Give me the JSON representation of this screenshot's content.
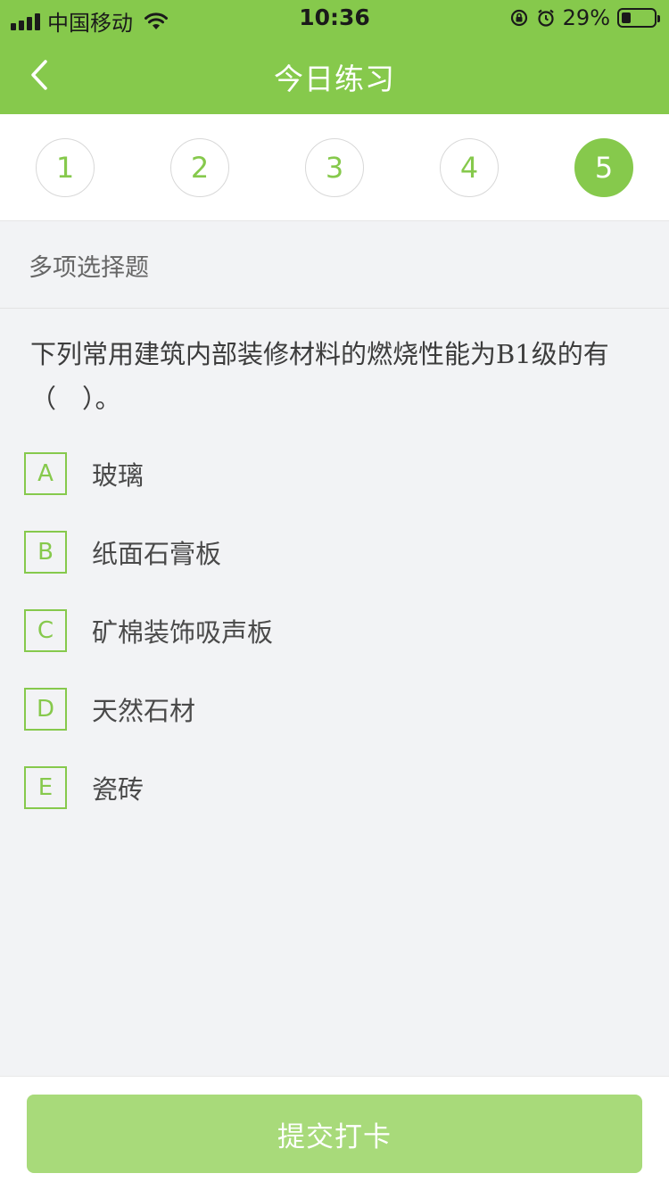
{
  "status_bar": {
    "carrier": "中国移动",
    "time": "10:36",
    "battery_percent": "29%",
    "battery_level": 0.29,
    "icons": [
      "signal-icon",
      "wifi-icon",
      "rotation-lock-icon",
      "alarm-icon",
      "battery-icon"
    ]
  },
  "header": {
    "title": "今日练习",
    "back_icon": "chevron-left-icon"
  },
  "steps": [
    {
      "label": "1",
      "active": false
    },
    {
      "label": "2",
      "active": false
    },
    {
      "label": "3",
      "active": false
    },
    {
      "label": "4",
      "active": false
    },
    {
      "label": "5",
      "active": true
    }
  ],
  "question": {
    "type": "多项选择题",
    "text_line1": "下列常用建筑内部装修材料的燃烧性能为B1级的有",
    "text_line2": "（　）。",
    "options": [
      {
        "letter": "A",
        "text": "玻璃"
      },
      {
        "letter": "B",
        "text": "纸面石膏板"
      },
      {
        "letter": "C",
        "text": "矿棉装饰吸声板"
      },
      {
        "letter": "D",
        "text": "天然石材"
      },
      {
        "letter": "E",
        "text": "瓷砖"
      }
    ]
  },
  "footer": {
    "submit_label": "提交打卡"
  },
  "colors": {
    "accent": "#86c94c",
    "button_disabled": "#a8da7a",
    "background": "#f2f3f5"
  }
}
